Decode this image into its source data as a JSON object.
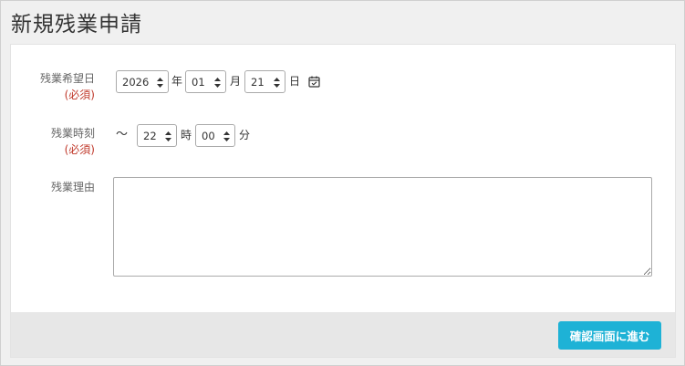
{
  "page": {
    "title": "新規残業申請"
  },
  "form": {
    "date": {
      "label": "残業希望日",
      "required": "(必須)",
      "year": "2026",
      "year_unit": "年",
      "month": "01",
      "month_unit": "月",
      "day": "21",
      "day_unit": "日",
      "calendar_icon": "calendar-icon"
    },
    "time": {
      "label": "残業時刻",
      "required": "(必須)",
      "prefix": "〜",
      "hour": "22",
      "hour_unit": "時",
      "minute": "00",
      "minute_unit": "分"
    },
    "reason": {
      "label": "残業理由",
      "value": ""
    }
  },
  "footer": {
    "submit_label": "確認画面に進む"
  },
  "colors": {
    "accent": "#1eb2d6",
    "required": "#c0392b",
    "footer_bg": "#e7e7e7"
  }
}
